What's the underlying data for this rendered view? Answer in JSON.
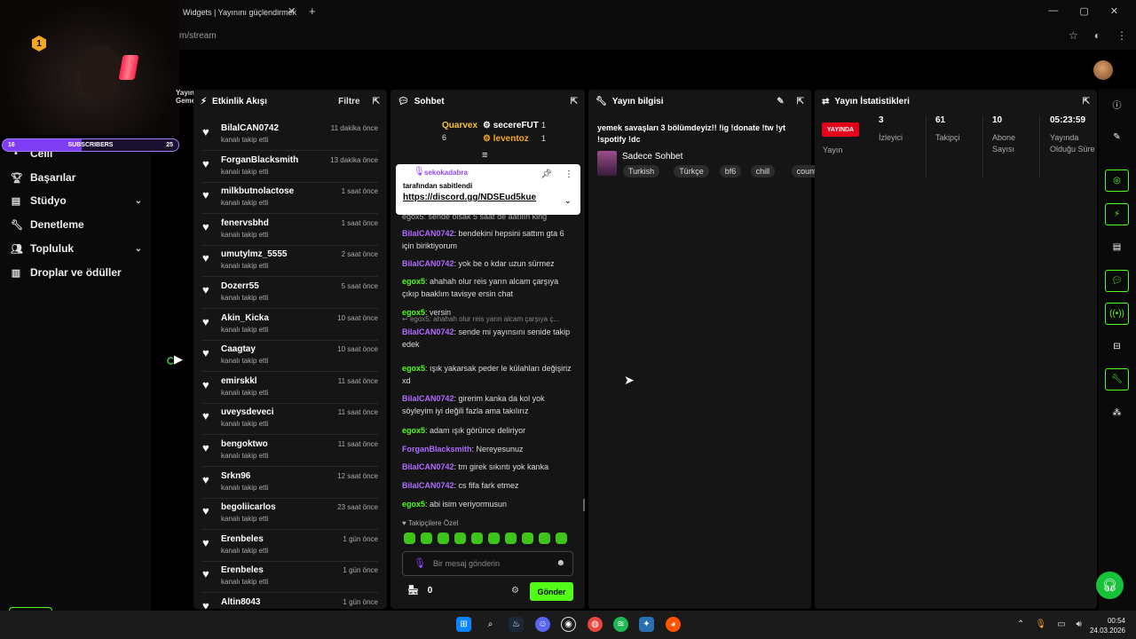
{
  "browser": {
    "tab_title": "Widgets | Yayınını güçlendirmek",
    "tab_close": "✕",
    "new_tab": "+",
    "url": "m/stream",
    "window_controls": [
      "—",
      "▢",
      "✕"
    ]
  },
  "webcam_overlay": {
    "sub_goal_start": "16",
    "sub_goal_label": "SUBSCRIBERS",
    "sub_goal_end": "25",
    "progress_fraction": 0.45
  },
  "sidenav": {
    "partial_top": "Celli",
    "items": [
      {
        "label": "Başarılar",
        "icon": "trophy-icon",
        "chevron": false
      },
      {
        "label": "Stüdyo",
        "icon": "studio-icon",
        "chevron": true
      },
      {
        "label": "Denetleme",
        "icon": "wrench-icon",
        "chevron": false
      },
      {
        "label": "Topluluk",
        "icon": "people-icon",
        "chevron": true
      },
      {
        "label": "Droplar ve ödüller",
        "icon": "drops-icon",
        "chevron": false
      }
    ]
  },
  "narrow_column_label": "Yayın Geme",
  "activity": {
    "title": "Etkinlik Akışı",
    "filter": "Filtre",
    "items": [
      {
        "user": "BilalCAN0742",
        "action": "kanalı takip etti",
        "time": "11 dakika önce"
      },
      {
        "user": "ForganBlacksmith",
        "action": "kanalı takip etti",
        "time": "13 dakika önce"
      },
      {
        "user": "milkbutnolactose",
        "action": "kanalı takip etti",
        "time": "1 saat önce"
      },
      {
        "user": "fenervsbhd",
        "action": "kanalı takip etti",
        "time": "1 saat önce"
      },
      {
        "user": "umutylmz_5555",
        "action": "kanalı takip etti",
        "time": "2 saat önce"
      },
      {
        "user": "Dozerr55",
        "action": "kanalı takip etti",
        "time": "5 saat önce"
      },
      {
        "user": "Akin_Kicka",
        "action": "kanalı takip etti",
        "time": "10 saat önce"
      },
      {
        "user": "Caagtay",
        "action": "kanalı takip etti",
        "time": "10 saat önce"
      },
      {
        "user": "emirskkl",
        "action": "kanalı takip etti",
        "time": "11 saat önce"
      },
      {
        "user": "uveysdeveci",
        "action": "kanalı takip etti",
        "time": "11 saat önce"
      },
      {
        "user": "bengoktwo",
        "action": "kanalı takip etti",
        "time": "11 saat önce"
      },
      {
        "user": "Srkn96",
        "action": "kanalı takip etti",
        "time": "12 saat önce"
      },
      {
        "user": "begoliicarlos",
        "action": "kanalı takip etti",
        "time": "23 saat önce"
      },
      {
        "user": "Erenbeles",
        "action": "kanalı takip etti",
        "time": "1 gün önce"
      },
      {
        "user": "Erenbeles",
        "action": "kanalı takip etti",
        "time": "1 gün önce"
      },
      {
        "user": "Altin8043",
        "action": "",
        "time": "1 gün önce"
      }
    ]
  },
  "chat": {
    "title": "Sohbet",
    "top_gifters": [
      {
        "name": "Quarvex",
        "count": "6"
      },
      {
        "name": "secereFUT",
        "count": "1"
      },
      {
        "name": "leventoz",
        "count": "1"
      }
    ],
    "top_badge": "1",
    "pinned": {
      "user": "sekokadabra",
      "label": "tarafından sabitlendi",
      "link": "https://discord.gg/NDSEud5kue"
    },
    "partial_message": "egox5: sende olsak 5 saat de aatılın king",
    "messages": [
      {
        "user": "BilalCAN0742",
        "color": "purple",
        "text": ": bendekini hepsini sattım gta 6 için biriktiyorum"
      },
      {
        "user": "BilalCAN0742",
        "color": "purple",
        "text": ": yok be o kdar uzun sürmez"
      },
      {
        "user": "egox5",
        "color": "green",
        "text": ": ahahah olur reis yarın alcam çarşıya çıkıp baaklım tavisye ersin chat"
      },
      {
        "user": "egox5",
        "color": "green",
        "text": ": versin"
      },
      {
        "reply": "egox5: ahahah olur reis yarın alcam çarşıya ç...",
        "user": "BilalCAN0742",
        "color": "purple",
        "text": ": sende mi yayınsını senide takip edek"
      },
      {
        "user": "egox5",
        "color": "green",
        "text": ": ışık yakarsak peder le külahları değişiriz xd"
      },
      {
        "user": "BilalCAN0742",
        "color": "purple",
        "text": ": girerim kanka da kol yok söyleyim iyi değili fazla ama takılırız"
      },
      {
        "user": "egox5",
        "color": "green",
        "text": ": adam ışık görünce deliriyor"
      },
      {
        "user": "ForganBlacksmith",
        "color": "purple",
        "text": ": Nereyesunuz"
      },
      {
        "user": "BilalCAN0742",
        "color": "purple",
        "text": ": tm girek sıkıntı yok kanka"
      },
      {
        "user": "BilalCAN0742",
        "color": "purple",
        "text": ": cs fifa fark etmez"
      },
      {
        "user": "egox5",
        "color": "green",
        "text": ": abi isim veriyormusun"
      }
    ],
    "followers_only": "Takipçilere Özel",
    "input_placeholder": "Bir mesaj gönderin",
    "points": "0",
    "send": "Gönder"
  },
  "stream_info": {
    "title": "Yayın bilgisi",
    "stream_title": "yemek savaşları 3 bölümdeyiz!! !ig !donate !tw !yt !spotify !dc",
    "category": "Sadece Sohbet",
    "tags": [
      "Turkish",
      "Türkçe",
      "bf6",
      "chill",
      "counters"
    ]
  },
  "stats": {
    "title": "Yayın İstatistikleri",
    "live": "YAYINDA",
    "live_label": "Yayın",
    "items": [
      {
        "value": "3",
        "label": "İzleyici"
      },
      {
        "value": "61",
        "label": "Takipçi"
      },
      {
        "value": "10",
        "label": "Abone Sayısı"
      },
      {
        "value": "05:23:59",
        "label": "Yayında Olduğu Süre"
      }
    ]
  },
  "kick_logo": {
    "k": "K",
    "count": "3"
  },
  "taskbar": {
    "clock_time": "00:54",
    "clock_date": "24.03.2026"
  }
}
